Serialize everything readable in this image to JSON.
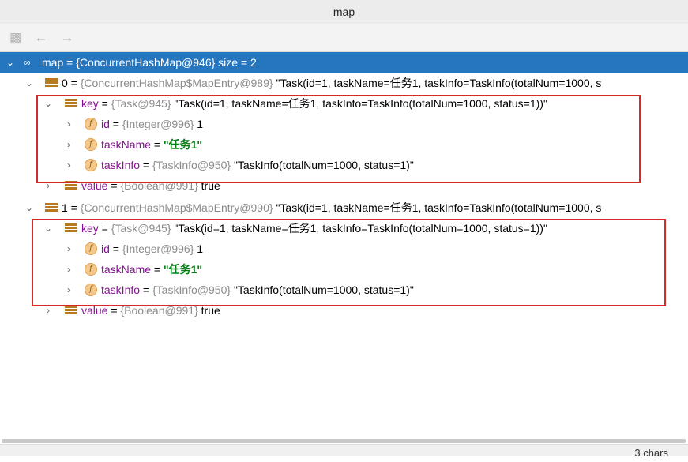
{
  "window": {
    "title": "map"
  },
  "toolbar": {
    "buttons": [
      "frames-icon",
      "back-icon",
      "forward-icon"
    ]
  },
  "tree": {
    "root": {
      "name": "map",
      "eq": " = ",
      "ref": "{ConcurrentHashMap@946}",
      "extra": "  size = 2"
    },
    "entries": [
      {
        "name": "0",
        "eq": " = ",
        "ref": "{ConcurrentHashMap$MapEntry@989}",
        "value": " \"Task(id=1, taskName=任务1, taskInfo=TaskInfo(totalNum=1000, s",
        "key": {
          "name": "key",
          "eq": " = ",
          "ref": "{Task@945}",
          "value": " \"Task(id=1, taskName=任务1, taskInfo=TaskInfo(totalNum=1000, status=1))\""
        },
        "fields": [
          {
            "name": "id",
            "eq": " = ",
            "ref": "{Integer@996}",
            "value": " 1"
          },
          {
            "name": "taskName",
            "eq": " = ",
            "ref": "",
            "value": "\"任务1\""
          },
          {
            "name": "taskInfo",
            "eq": " = ",
            "ref": "{TaskInfo@950}",
            "value": " \"TaskInfo(totalNum=1000, status=1)\""
          }
        ],
        "val": {
          "name": "value",
          "eq": " = ",
          "ref": "{Boolean@991}",
          "value": " true"
        }
      },
      {
        "name": "1",
        "eq": " = ",
        "ref": "{ConcurrentHashMap$MapEntry@990}",
        "value": " \"Task(id=1, taskName=任务1, taskInfo=TaskInfo(totalNum=1000, s",
        "key": {
          "name": "key",
          "eq": " = ",
          "ref": "{Task@945}",
          "value": " \"Task(id=1, taskName=任务1, taskInfo=TaskInfo(totalNum=1000, status=1))\""
        },
        "fields": [
          {
            "name": "id",
            "eq": " = ",
            "ref": "{Integer@996}",
            "value": " 1"
          },
          {
            "name": "taskName",
            "eq": " = ",
            "ref": "",
            "value": "\"任务1\""
          },
          {
            "name": "taskInfo",
            "eq": " = ",
            "ref": "{TaskInfo@950}",
            "value": " \"TaskInfo(totalNum=1000, status=1)\""
          }
        ],
        "val": {
          "name": "value",
          "eq": " = ",
          "ref": "{Boolean@991}",
          "value": " true"
        }
      }
    ]
  },
  "status": {
    "text": "3 chars"
  },
  "colors": {
    "selection": "#2675bf",
    "highlight_box": "#d62a2a",
    "string_value": "#067d17"
  }
}
